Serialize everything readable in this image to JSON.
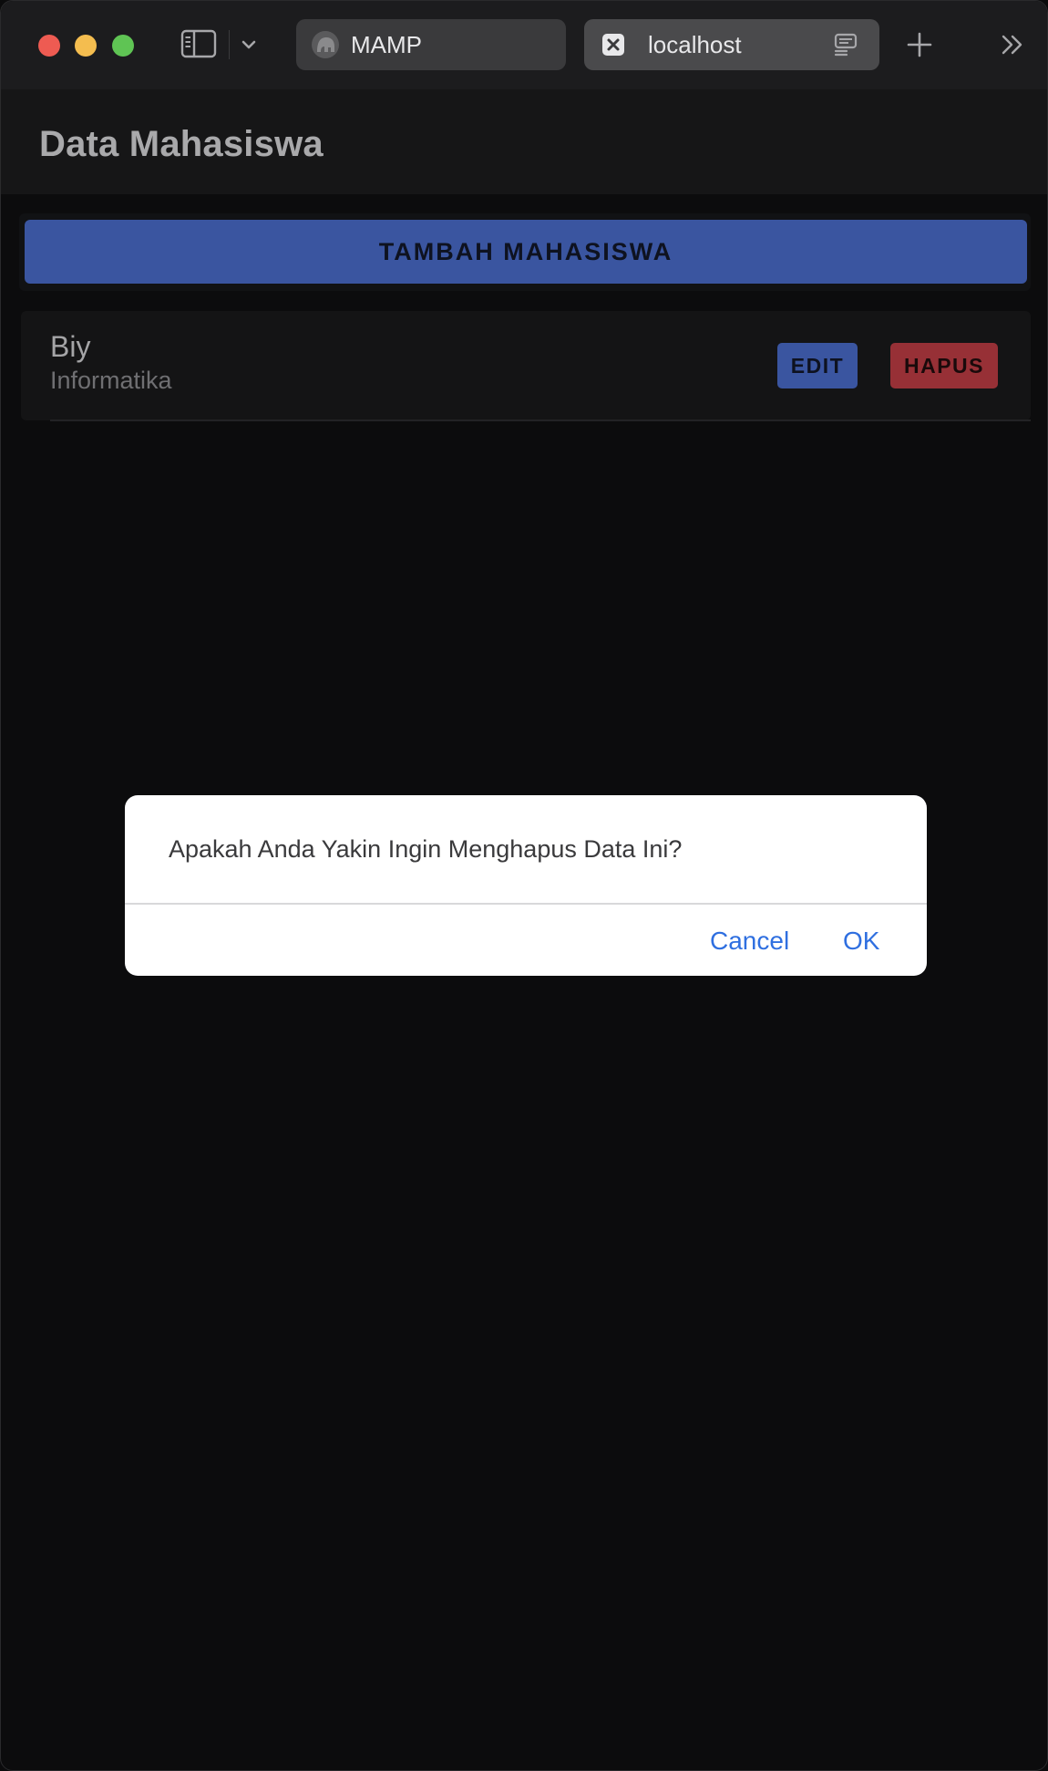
{
  "browser": {
    "tabs": [
      {
        "label": "MAMP",
        "favicon": "elephant-icon"
      },
      {
        "label": "localhost",
        "favicon": "close-icon"
      }
    ]
  },
  "app": {
    "title": "Data Mahasiswa",
    "add_button_label": "TAMBAH MAHASISWA"
  },
  "students": [
    {
      "name": "Biy",
      "program": "Informatika",
      "edit_label": "EDIT",
      "delete_label": "HAPUS"
    }
  ],
  "dialog": {
    "message": "Apakah Anda Yakin Ingin Menghapus Data Ini?",
    "cancel_label": "Cancel",
    "ok_label": "OK"
  },
  "colors": {
    "primary": "#3a55a0",
    "danger": "#973036",
    "dialog_link": "#2f6fe0"
  }
}
